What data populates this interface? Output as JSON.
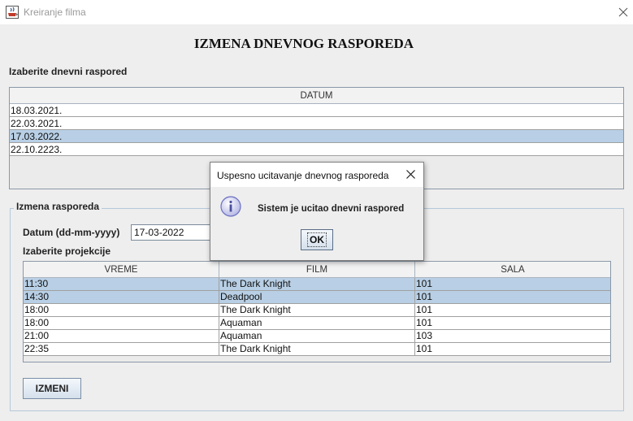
{
  "window": {
    "title": "Kreiranje filma",
    "app_icon": "java-cup-icon",
    "close_icon": "close-icon"
  },
  "heading": "IZMENA DNEVNOG RASPOREDA",
  "schedule_section": {
    "label": "Izaberite dnevni raspored",
    "column": "DATUM",
    "rows": [
      "18.03.2021.",
      "22.03.2021.",
      "17.03.2022.",
      "22.10.2223."
    ],
    "selected_index": 2
  },
  "edit_section": {
    "title": "Izmena rasporeda",
    "date_label": "Datum (dd-mm-yyyy)",
    "date_value": "17-03-2022",
    "projections_label": "Izaberite projekcije",
    "columns": [
      "VREME",
      "FILM",
      "SALA"
    ],
    "rows": [
      [
        "11:30",
        "The Dark Knight",
        "101"
      ],
      [
        "14:30",
        "Deadpool",
        "101"
      ],
      [
        "18:00",
        "The Dark Knight",
        "101"
      ],
      [
        "18:00",
        "Aquaman",
        "101"
      ],
      [
        "21:00",
        "Aquaman",
        "103"
      ],
      [
        "22:35",
        "The Dark Knight",
        "101"
      ]
    ],
    "selected_indices": [
      0,
      1
    ],
    "button": "IZMENI"
  },
  "dialog": {
    "title": "Uspesno ucitavanje dnevnog rasporeda",
    "message": "Sistem je ucitao dnevni raspored",
    "ok": "OK",
    "icon": "info-icon",
    "close_icon": "close-icon"
  },
  "colors": {
    "selection": "#b8cfe5",
    "background": "#eeeeee",
    "border": "#8a98a8"
  }
}
